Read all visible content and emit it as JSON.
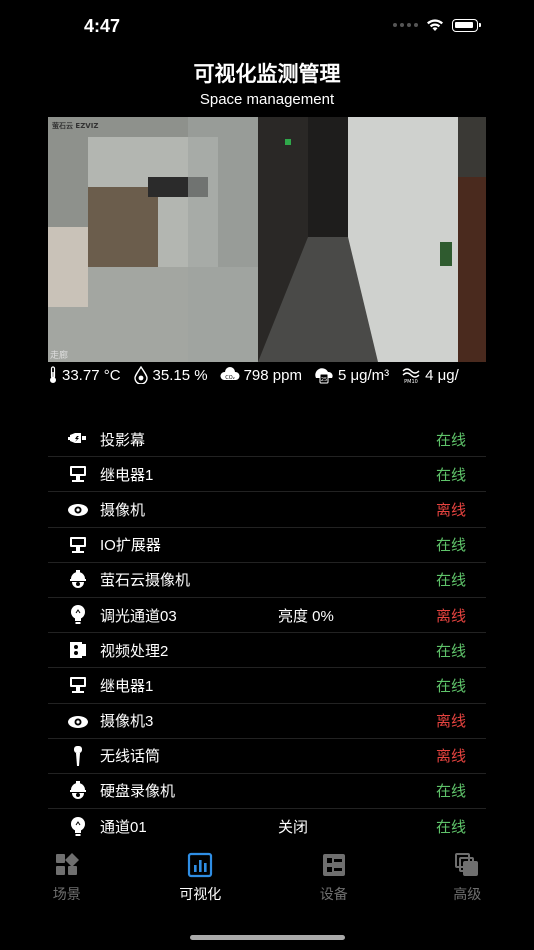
{
  "status_bar": {
    "time": "4:47"
  },
  "header": {
    "title": "可视化监测管理",
    "subtitle": "Space management"
  },
  "camera": {
    "overlay_label": "走廊",
    "logo_text": "萤石云 EZVIZ"
  },
  "sensors": [
    {
      "icon": "thermometer-icon",
      "value": "33.77 °C"
    },
    {
      "icon": "humidity-icon",
      "value": "35.15 %"
    },
    {
      "icon": "co2-icon",
      "value": "798 ppm"
    },
    {
      "icon": "pm25-icon",
      "value": "5 μg/m³"
    },
    {
      "icon": "pm10-icon",
      "value": "4 μg/"
    }
  ],
  "devices": [
    {
      "name": "投影幕",
      "extra": "",
      "status": "在线",
      "online": true,
      "icon": "projector-screen-icon"
    },
    {
      "name": "继电器1",
      "extra": "",
      "status": "在线",
      "online": true,
      "icon": "relay-icon"
    },
    {
      "name": "摄像机",
      "extra": "",
      "status": "离线",
      "online": false,
      "icon": "camera-icon"
    },
    {
      "name": "IO扩展器",
      "extra": "",
      "status": "在线",
      "online": true,
      "icon": "io-expander-icon"
    },
    {
      "name": "萤石云摄像机",
      "extra": "",
      "status": "在线",
      "online": true,
      "icon": "dome-camera-icon"
    },
    {
      "name": "调光通道03",
      "extra": "亮度 0%",
      "status": "离线",
      "online": false,
      "icon": "bulb-icon"
    },
    {
      "name": "视频处理2",
      "extra": "",
      "status": "在线",
      "online": true,
      "icon": "video-processor-icon"
    },
    {
      "name": "继电器1",
      "extra": "",
      "status": "在线",
      "online": true,
      "icon": "relay-icon"
    },
    {
      "name": "摄像机3",
      "extra": "",
      "status": "离线",
      "online": false,
      "icon": "camera-icon"
    },
    {
      "name": "无线话筒",
      "extra": "",
      "status": "离线",
      "online": false,
      "icon": "microphone-icon"
    },
    {
      "name": "硬盘录像机",
      "extra": "",
      "status": "在线",
      "online": true,
      "icon": "dome-camera-icon"
    },
    {
      "name": "通道01",
      "extra": "关闭",
      "status": "在线",
      "online": true,
      "icon": "bulb-icon"
    }
  ],
  "tabs": [
    {
      "label": "场景",
      "icon": "scene-icon",
      "active": false
    },
    {
      "label": "可视化",
      "icon": "chart-icon",
      "active": true
    },
    {
      "label": "设备",
      "icon": "device-icon",
      "active": false
    },
    {
      "label": "高级",
      "icon": "advanced-icon",
      "active": false
    }
  ],
  "colors": {
    "online": "#5fc36a",
    "offline": "#e5433f",
    "background": "#000000"
  }
}
